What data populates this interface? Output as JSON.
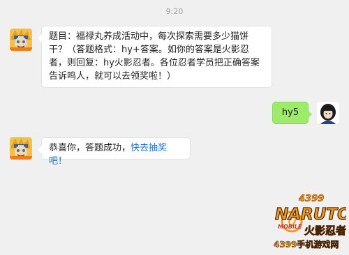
{
  "chat": {
    "time": "9:20",
    "messages": [
      {
        "side": "left",
        "text": "题目：福禄丸养成活动中，每次探索需要多少猫饼干？（答题格式：hy+答案。如你的答案是火影忍者，则回复：hy火影忍者。各位忍者学员把正确答案告诉鸣人，就可以去领奖啦！）"
      },
      {
        "side": "right",
        "text": "hy5"
      },
      {
        "side": "left",
        "text_prefix": "恭喜你，答题成功，",
        "link_text": "快去抽奖吧！"
      }
    ]
  },
  "watermark": {
    "number": "4399",
    "brand": "NARUTO",
    "sub": "MOBILE",
    "cn": "火影忍者",
    "site": "4399手机游戏网"
  },
  "colors": {
    "background": "#f0f0f0",
    "right_bubble": "#9eea6a",
    "link": "#1a6fd1",
    "logo_orange": "#f39a1e"
  }
}
